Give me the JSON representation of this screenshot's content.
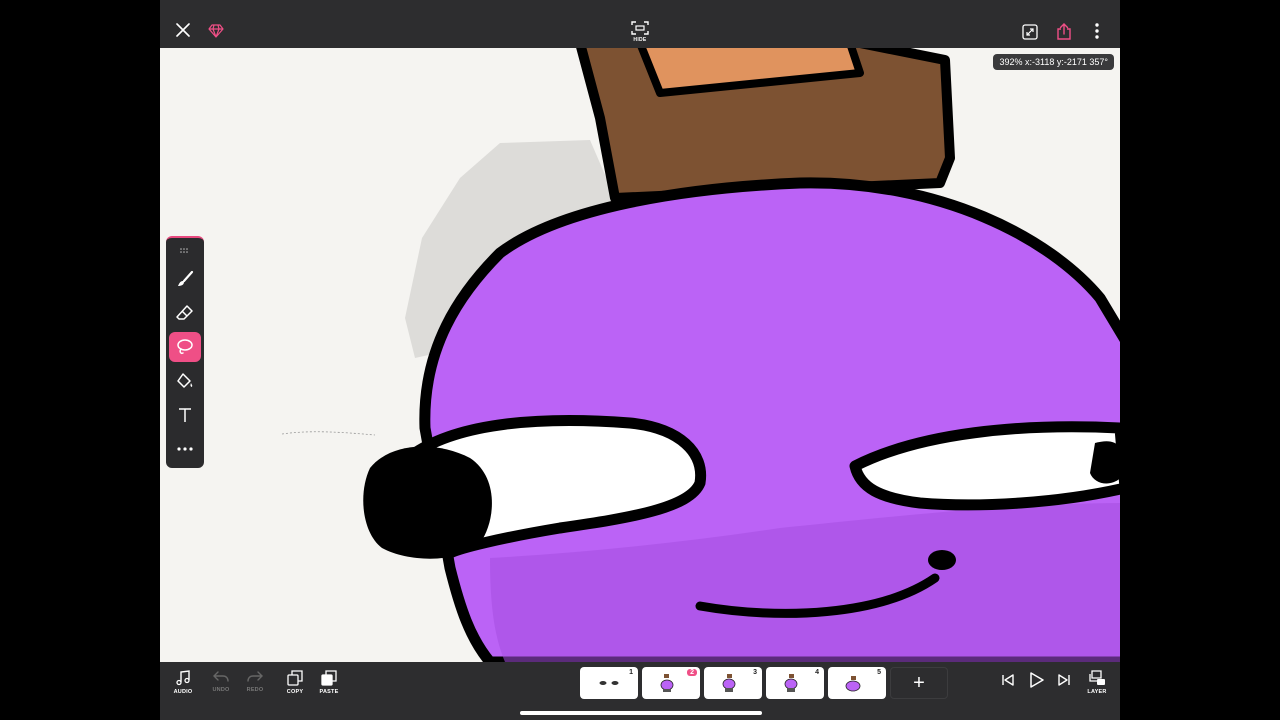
{
  "topbar": {
    "hide_label": "HIDE",
    "icons": [
      "close-icon",
      "gem-icon",
      "hide-ui-icon",
      "fit-screen-icon",
      "share-icon",
      "more-vertical-icon"
    ]
  },
  "canvas": {
    "zoom_readout": "392% x:-3118 y:-2171 357°"
  },
  "tools": {
    "items": [
      "brush",
      "eraser",
      "lasso",
      "fill",
      "text",
      "more"
    ],
    "active": "lasso"
  },
  "bottombar": {
    "audio_label": "AUDIO",
    "undo_label": "UNDO",
    "redo_label": "REDO",
    "copy_label": "COPY",
    "paste_label": "PASTE",
    "layer_label": "LAYER",
    "add_frame_label": "+",
    "frames": [
      {
        "num": "1",
        "current": false
      },
      {
        "num": "2",
        "current": true
      },
      {
        "num": "3",
        "current": false
      },
      {
        "num": "4",
        "current": false
      },
      {
        "num": "5",
        "current": false
      }
    ]
  },
  "colors": {
    "accent": "#ef4f86",
    "bar_bg": "#2d2d2f",
    "character_purple": "#bb63f6",
    "hat_brown": "#7d5232",
    "hat_tan": "#e0935e"
  }
}
